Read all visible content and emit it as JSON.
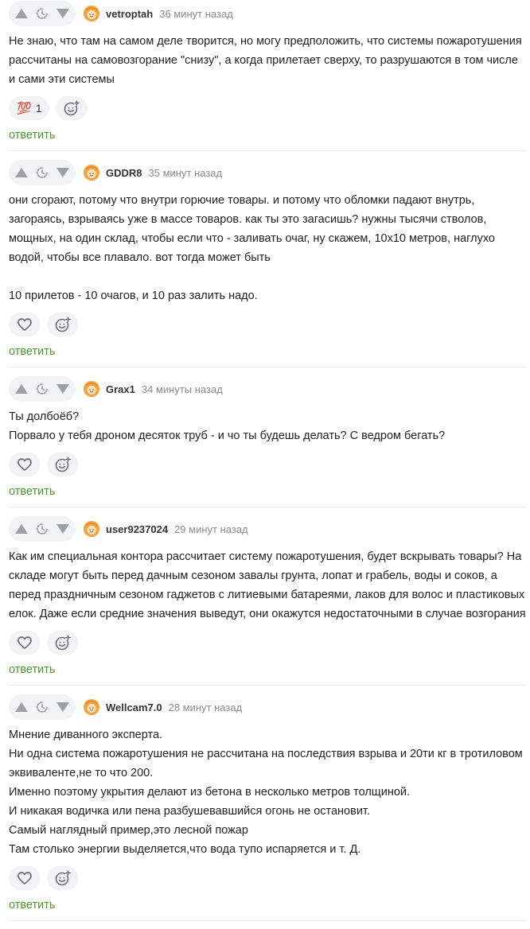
{
  "reply_label": "ответить",
  "reaction_emoji": "💯",
  "colors": {
    "reply_link": "#4c9a2a",
    "avatar": "#f6a33e",
    "pill_background": "#f2f3f5",
    "timestamp": "#8a8a8a"
  },
  "icons": {
    "upvote": "upvote-icon",
    "save": "save-icon",
    "downvote": "downvote-icon",
    "like": "heart-icon",
    "add_reaction": "add-emoji-icon"
  },
  "comments": [
    {
      "username": "vetroptah",
      "time": "36 минут назад",
      "body": [
        "Не знаю, что там на самом деле творится, но могу предположить, что системы пожаротушения рассчитаны на самовозгорание \"снизу\", а когда прилетает сверху, то разрушаются в том числе и сами эти системы"
      ],
      "reaction": {
        "type": "hundred",
        "count": "1"
      }
    },
    {
      "username": "GDDR8",
      "time": "35 минут назад",
      "body": [
        "они сгорают, потому что внутри горючие товары. и потому что обломки падают внутрь, загораясь, взрываясь уже в массе товаров. как ты это загасишь? нужны тысячи стволов, мощных, на один склад, чтобы если что - заливать очаг, ну скажем, 10х10 метров, наглухо водой, чтобы все плавало. вот тогда может быть",
        "",
        "10 прилетов - 10 очагов, и 10 раз залить надо."
      ],
      "reaction": {
        "type": "like",
        "count": ""
      }
    },
    {
      "username": "Grax1",
      "time": "34 минуты назад",
      "body": [
        "Ты долбоёб?",
        "Порвало у тебя дроном десяток труб - и чо ты будешь делать? С ведром бегать?"
      ],
      "reaction": {
        "type": "like",
        "count": ""
      }
    },
    {
      "username": "user9237024",
      "time": "29 минут назад",
      "body": [
        "Как им специальная контора рассчитает систему пожаротушения, будет вскрывать товары? На складе могут быть перед дачным сезоном завалы грунта, лопат и грабель, воды и соков, а перед праздничным сезоном гаджетов с литиевыми батареями, лаков для волос и пластиковых елок. Даже если средние значения выведут, они окажутся недостаточными в случае возгорания"
      ],
      "reaction": {
        "type": "like",
        "count": ""
      }
    },
    {
      "username": "Wellcam7.0",
      "time": "28 минут назад",
      "body": [
        "Мнение диванного эксперта.",
        "Ни одна система пожаротушения не рассчитана на последствия взрыва и 20ти кг в тротиловом эквиваленте,не то что 200.",
        "Именно поэтому укрытия делают из бетона в несколько метров толщиной.",
        "И никакая водичка или пена разбушевавшийся огонь не остановит.",
        "Самый наглядный пример,это лесной пожар",
        "Там столько энергии выделяется,что вода тупо испаряется и т. Д."
      ],
      "reaction": {
        "type": "like",
        "count": ""
      }
    }
  ]
}
